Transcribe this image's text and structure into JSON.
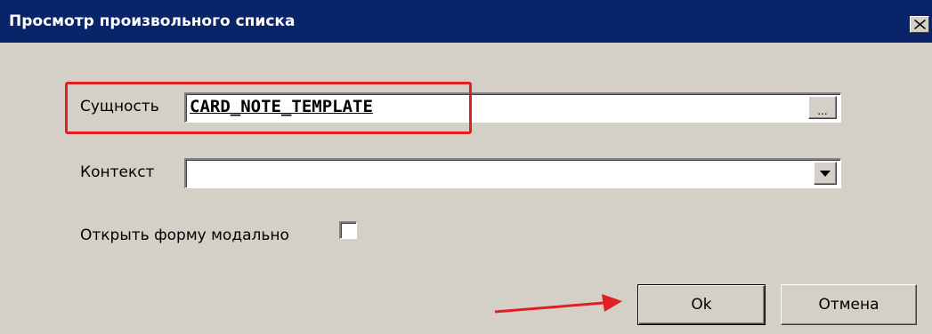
{
  "window": {
    "title": "Просмотр произвольного списка",
    "close_label": "×"
  },
  "form": {
    "entity": {
      "label": "Сущность",
      "value": "CARD_NOTE_TEMPLATE",
      "browse_label": "..."
    },
    "context": {
      "label": "Контекст",
      "value": ""
    },
    "modal": {
      "label": "Открыть форму модально",
      "checked": false
    }
  },
  "buttons": {
    "ok": "Ok",
    "cancel": "Отмена"
  },
  "annotations": {
    "highlight_color": "#e02020",
    "arrow_color": "#e02020"
  },
  "colors": {
    "titlebar": "#0a246a",
    "window_bg": "#d4d0c8"
  }
}
